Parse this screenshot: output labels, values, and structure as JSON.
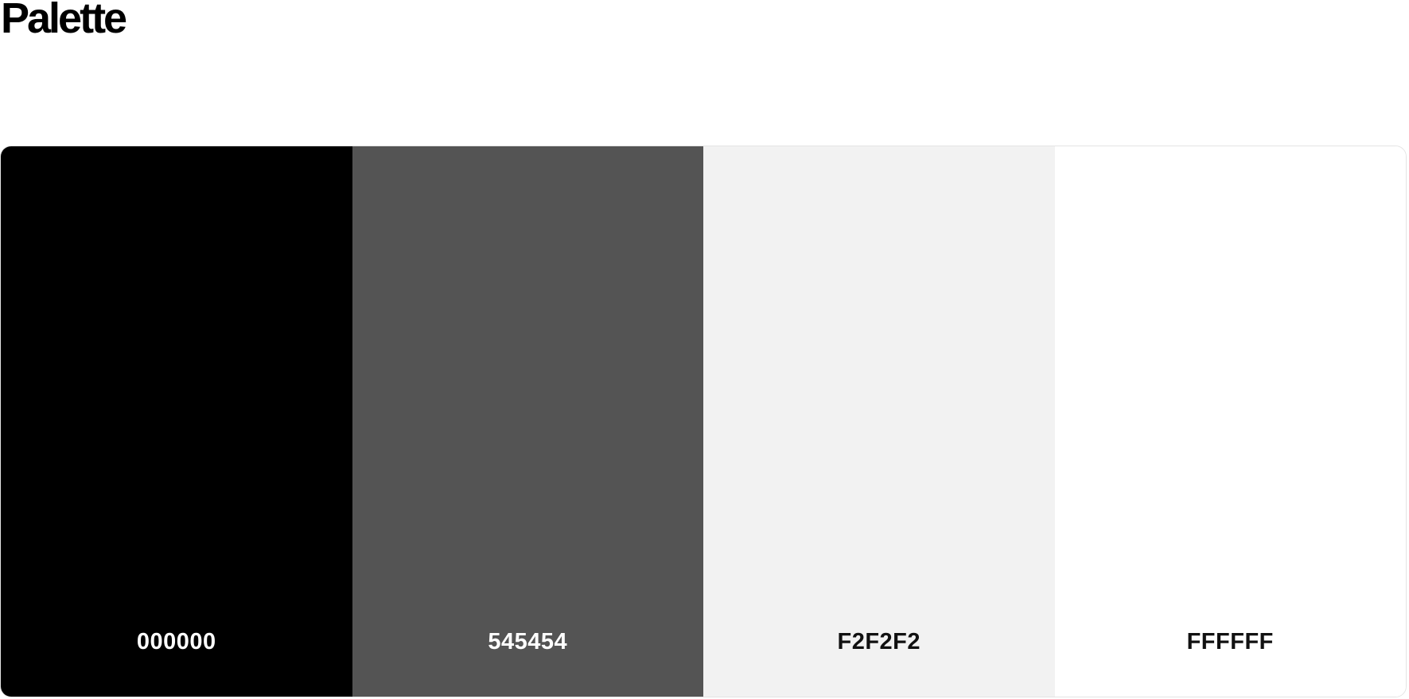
{
  "title": "Palette",
  "swatches": [
    {
      "hex": "000000",
      "color": "#000000",
      "text_color": "#ffffff"
    },
    {
      "hex": "545454",
      "color": "#545454",
      "text_color": "#ffffff"
    },
    {
      "hex": "F2F2F2",
      "color": "#f2f2f2",
      "text_color": "#111111"
    },
    {
      "hex": "FFFFFF",
      "color": "#ffffff",
      "text_color": "#111111"
    }
  ]
}
